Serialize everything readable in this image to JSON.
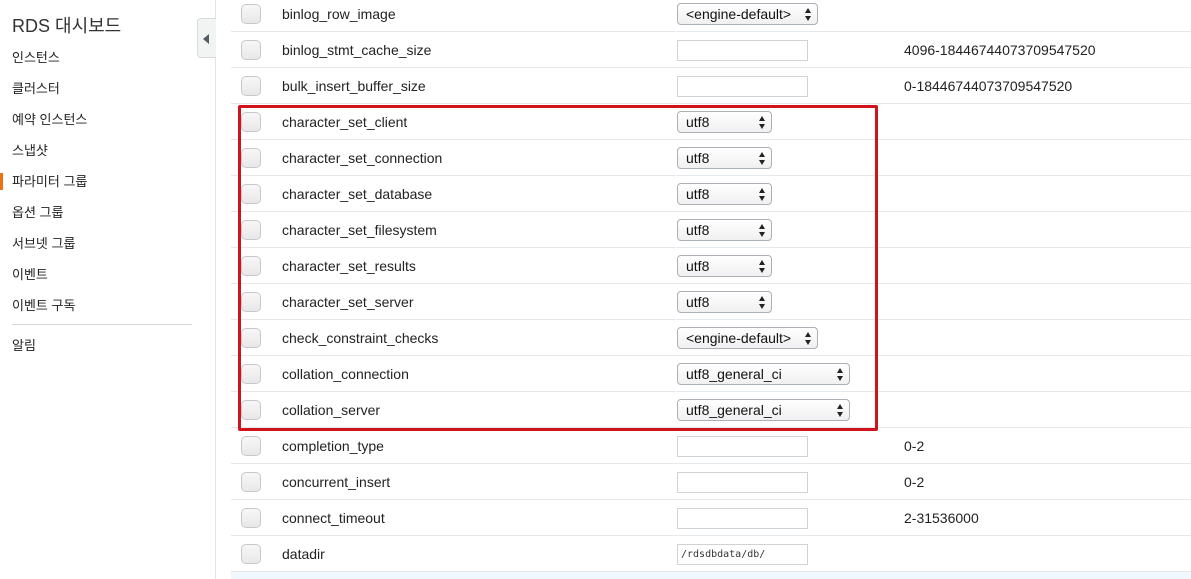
{
  "sidebar": {
    "title": "RDS 대시보드",
    "items": [
      {
        "label": "인스턴스"
      },
      {
        "label": "클러스터"
      },
      {
        "label": "예약 인스턴스"
      },
      {
        "label": "스냅샷"
      },
      {
        "label": "파라미터 그룹",
        "active": true
      },
      {
        "label": "옵션 그룹"
      },
      {
        "label": "서브넷 그룹"
      },
      {
        "label": "이벤트"
      },
      {
        "label": "이벤트 구독"
      }
    ],
    "alarm_label": "알림"
  },
  "parameters": [
    {
      "name": "binlog_row_image",
      "type": "select",
      "value": "<engine-default>",
      "range": ""
    },
    {
      "name": "binlog_stmt_cache_size",
      "type": "text",
      "value": "",
      "range": "4096-18446744073709547520"
    },
    {
      "name": "bulk_insert_buffer_size",
      "type": "text",
      "value": "",
      "range": "0-18446744073709547520"
    },
    {
      "name": "character_set_client",
      "type": "select",
      "value": "utf8",
      "range": ""
    },
    {
      "name": "character_set_connection",
      "type": "select",
      "value": "utf8",
      "range": ""
    },
    {
      "name": "character_set_database",
      "type": "select",
      "value": "utf8",
      "range": ""
    },
    {
      "name": "character_set_filesystem",
      "type": "select",
      "value": "utf8",
      "range": ""
    },
    {
      "name": "character_set_results",
      "type": "select",
      "value": "utf8",
      "range": ""
    },
    {
      "name": "character_set_server",
      "type": "select",
      "value": "utf8",
      "range": ""
    },
    {
      "name": "check_constraint_checks",
      "type": "select",
      "value": "<engine-default>",
      "range": ""
    },
    {
      "name": "collation_connection",
      "type": "select",
      "value": "utf8_general_ci",
      "range": ""
    },
    {
      "name": "collation_server",
      "type": "select",
      "value": "utf8_general_ci",
      "range": ""
    },
    {
      "name": "completion_type",
      "type": "text",
      "value": "",
      "range": "0-2"
    },
    {
      "name": "concurrent_insert",
      "type": "text",
      "value": "",
      "range": "0-2"
    },
    {
      "name": "connect_timeout",
      "type": "text",
      "value": "",
      "range": "2-31536000"
    },
    {
      "name": "datadir",
      "type": "text",
      "value": "/rdsdbdata/db/",
      "range": ""
    }
  ],
  "colors": {
    "highlight": "#d0141e",
    "active_nav": "#ec7211"
  }
}
